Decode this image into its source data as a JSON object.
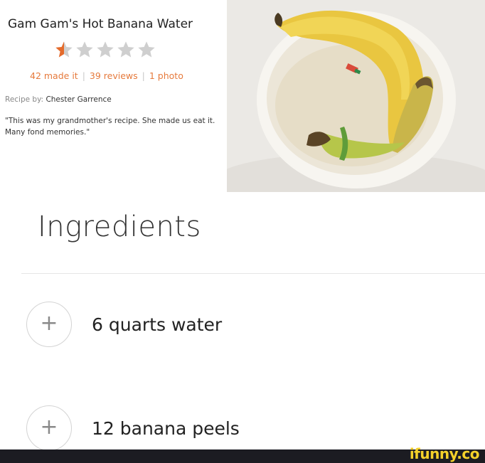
{
  "recipe": {
    "title": "Gam Gam's Hot Banana Water",
    "rating": 0.5,
    "rating_max": 5,
    "stats": {
      "made_it": "42 made it",
      "reviews": "39 reviews",
      "photos": "1 photo",
      "separator": "|"
    },
    "author_prefix": "Recipe by:",
    "author_name": "Chester Garrence",
    "quote": "\"This was my grandmother's recipe. She made us eat it. Many fond memories.\""
  },
  "ingredients": {
    "heading": "Ingredients",
    "items": [
      {
        "text": "6 quarts water",
        "button_label": "+"
      },
      {
        "text": "12 banana peels",
        "button_label": "+"
      }
    ]
  },
  "watermark": "ifunny.co",
  "colors": {
    "star_active": "#e46b2c",
    "star_inactive": "#cfcfcf",
    "stats_link": "#e67a3c",
    "footer_bar": "#1c1c22",
    "watermark": "#f4d12a"
  }
}
